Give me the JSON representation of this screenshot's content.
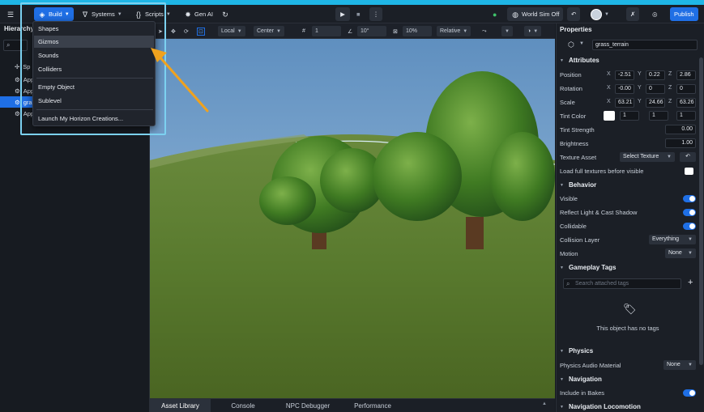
{
  "toolbar": {
    "menu_icon": "hamburger-icon",
    "build_label": "Build",
    "systems_label": "Systems",
    "scripts_label": "Scripts",
    "genai_label": "Gen AI",
    "world_sim_label": "World Sim Off",
    "publish_label": "Publish"
  },
  "menu": {
    "items": [
      "Shapes",
      "Gizmos",
      "Sounds",
      "Colliders",
      "Empty Object",
      "Sublevel",
      "Launch My Horizon Creations..."
    ],
    "highlighted": "Gizmos"
  },
  "row2": {
    "local_label": "Local",
    "center_label": "Center",
    "grid_value": "1",
    "angle_value": "10°",
    "scale_value": "10%",
    "relative_label": "Relative"
  },
  "hierarchy": {
    "title": "Hierarchy",
    "rows": [
      "Sp",
      "App",
      "App",
      "gra",
      "App"
    ]
  },
  "bottom_tabs": [
    "Asset Library",
    "Console",
    "NPC Debugger",
    "Performance"
  ],
  "properties": {
    "title": "Properties",
    "object_name": "grass_terrain",
    "attributes_title": "Attributes",
    "position": {
      "label": "Position",
      "x": "-2.51",
      "y": "0.22",
      "z": "2.86"
    },
    "rotation": {
      "label": "Rotation",
      "x": "-0.00",
      "y": "0",
      "z": "0"
    },
    "scale": {
      "label": "Scale",
      "x": "63.21",
      "y": "24.66",
      "z": "63.26"
    },
    "tint_color": {
      "label": "Tint Color",
      "r": "1",
      "g": "1",
      "b": "1"
    },
    "tint_strength": {
      "label": "Tint Strength",
      "value": "0.00"
    },
    "brightness": {
      "label": "Brightness",
      "value": "1.00"
    },
    "texture_asset": {
      "label": "Texture Asset",
      "button": "Select Texture"
    },
    "load_full": {
      "label": "Load full textures before visible",
      "on": false
    },
    "behavior_title": "Behavior",
    "visible": {
      "label": "Visible",
      "on": true
    },
    "reflect": {
      "label": "Reflect Light & Cast Shadow",
      "on": true
    },
    "collidable": {
      "label": "Collidable",
      "on": true
    },
    "collision_layer": {
      "label": "Collision Layer",
      "value": "Everything"
    },
    "motion": {
      "label": "Motion",
      "value": "None"
    },
    "gameplay_tags_title": "Gameplay Tags",
    "search_tags_placeholder": "Search attached tags",
    "no_tags_text": "This object has no tags",
    "physics_title": "Physics",
    "physics_audio": {
      "label": "Physics Audio Material",
      "value": "None"
    },
    "navigation_title": "Navigation",
    "include_bakes": {
      "label": "Include in Bakes",
      "on": true
    },
    "nav_locomotion_title": "Navigation Locomotion"
  },
  "colors": {
    "accent": "#1f6fe5",
    "highlight_box": "#7cd1f0",
    "arrow": "#f0a21e"
  }
}
